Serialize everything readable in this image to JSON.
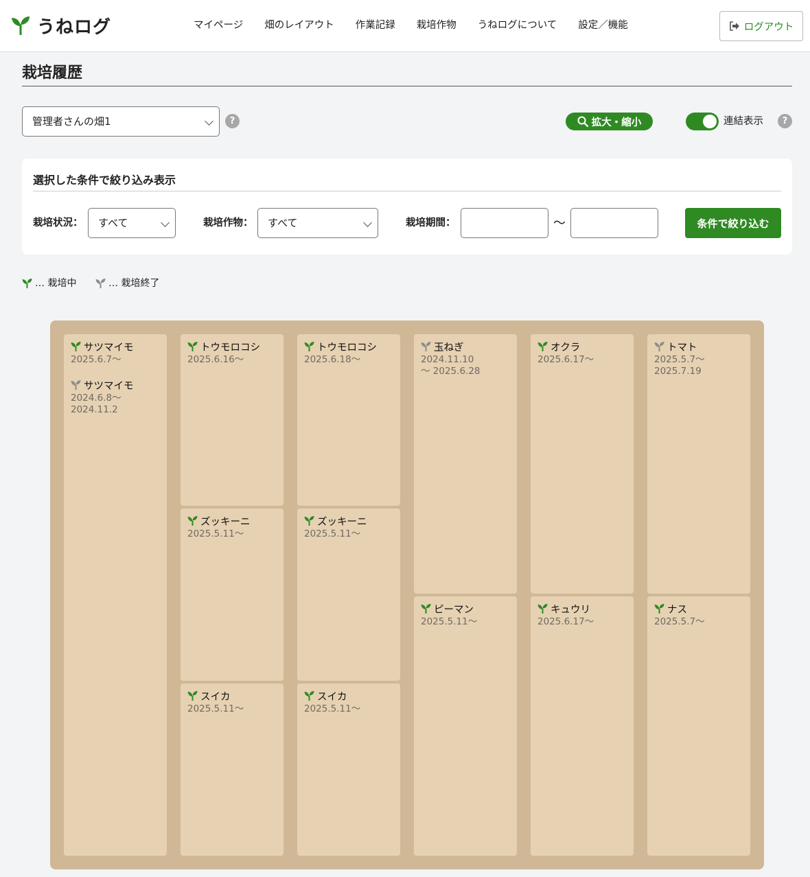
{
  "app": {
    "name": "うねログ",
    "colors": {
      "accent": "#2f8a24",
      "ended": "#8c8c8c",
      "board": "#d0b896",
      "plot": "#e6d1b2"
    }
  },
  "nav": [
    "マイページ",
    "畑のレイアウト",
    "作業記録",
    "栽培作物",
    "うねログについて",
    "設定／機能"
  ],
  "logout_label": "ログアウト",
  "page_title": "栽培履歴",
  "field_select": {
    "value": "管理者さんの畑1"
  },
  "help_icon": "?",
  "zoom_label": "拡大・縮小",
  "toggle": {
    "label": "連結表示",
    "on": true
  },
  "filter": {
    "title": "選択した条件で絞り込み表示",
    "status_label": "栽培状況：",
    "status_value": "すべて",
    "crop_label": "栽培作物：",
    "crop_value": "すべて",
    "period_label": "栽培期間：",
    "period_start": "",
    "period_end": "",
    "tilde": "〜",
    "submit": "条件で絞り込む"
  },
  "legend": {
    "active": "… 栽培中",
    "ended": "… 栽培終了"
  },
  "plots": [
    {
      "crops": [
        {
          "name": "サツマイモ",
          "date": "2025.6.7〜",
          "status": "active"
        },
        {
          "name": "サツマイモ",
          "date": "2024.6.8〜2024.11.2",
          "status": "ended"
        }
      ]
    },
    {
      "crops": [
        {
          "name": "トウモロコシ",
          "date": "2025.6.16〜",
          "status": "active"
        }
      ]
    },
    {
      "crops": [
        {
          "name": "ズッキーニ",
          "date": "2025.5.11〜",
          "status": "active"
        }
      ]
    },
    {
      "crops": [
        {
          "name": "スイカ",
          "date": "2025.5.11〜",
          "status": "active"
        }
      ]
    },
    {
      "crops": [
        {
          "name": "トウモロコシ",
          "date": "2025.6.18〜",
          "status": "active"
        }
      ]
    },
    {
      "crops": [
        {
          "name": "ズッキーニ",
          "date": "2025.5.11〜",
          "status": "active"
        }
      ]
    },
    {
      "crops": [
        {
          "name": "スイカ",
          "date": "2025.5.11〜",
          "status": "active"
        }
      ]
    },
    {
      "crops": [
        {
          "name": "玉ねぎ",
          "date": "2024.11.10〜 2025.6.28",
          "status": "ended"
        }
      ]
    },
    {
      "crops": [
        {
          "name": "ピーマン",
          "date": "2025.5.11〜",
          "status": "active"
        }
      ]
    },
    {
      "crops": [
        {
          "name": "オクラ",
          "date": "2025.6.17〜",
          "status": "active"
        }
      ]
    },
    {
      "crops": [
        {
          "name": "キュウリ",
          "date": "2025.6.17〜",
          "status": "active"
        }
      ]
    },
    {
      "crops": [
        {
          "name": "トマト",
          "date": "2025.5.7〜2025.7.19",
          "status": "ended"
        }
      ]
    },
    {
      "crops": [
        {
          "name": "ナス",
          "date": "2025.5.7〜",
          "status": "active"
        }
      ]
    }
  ]
}
